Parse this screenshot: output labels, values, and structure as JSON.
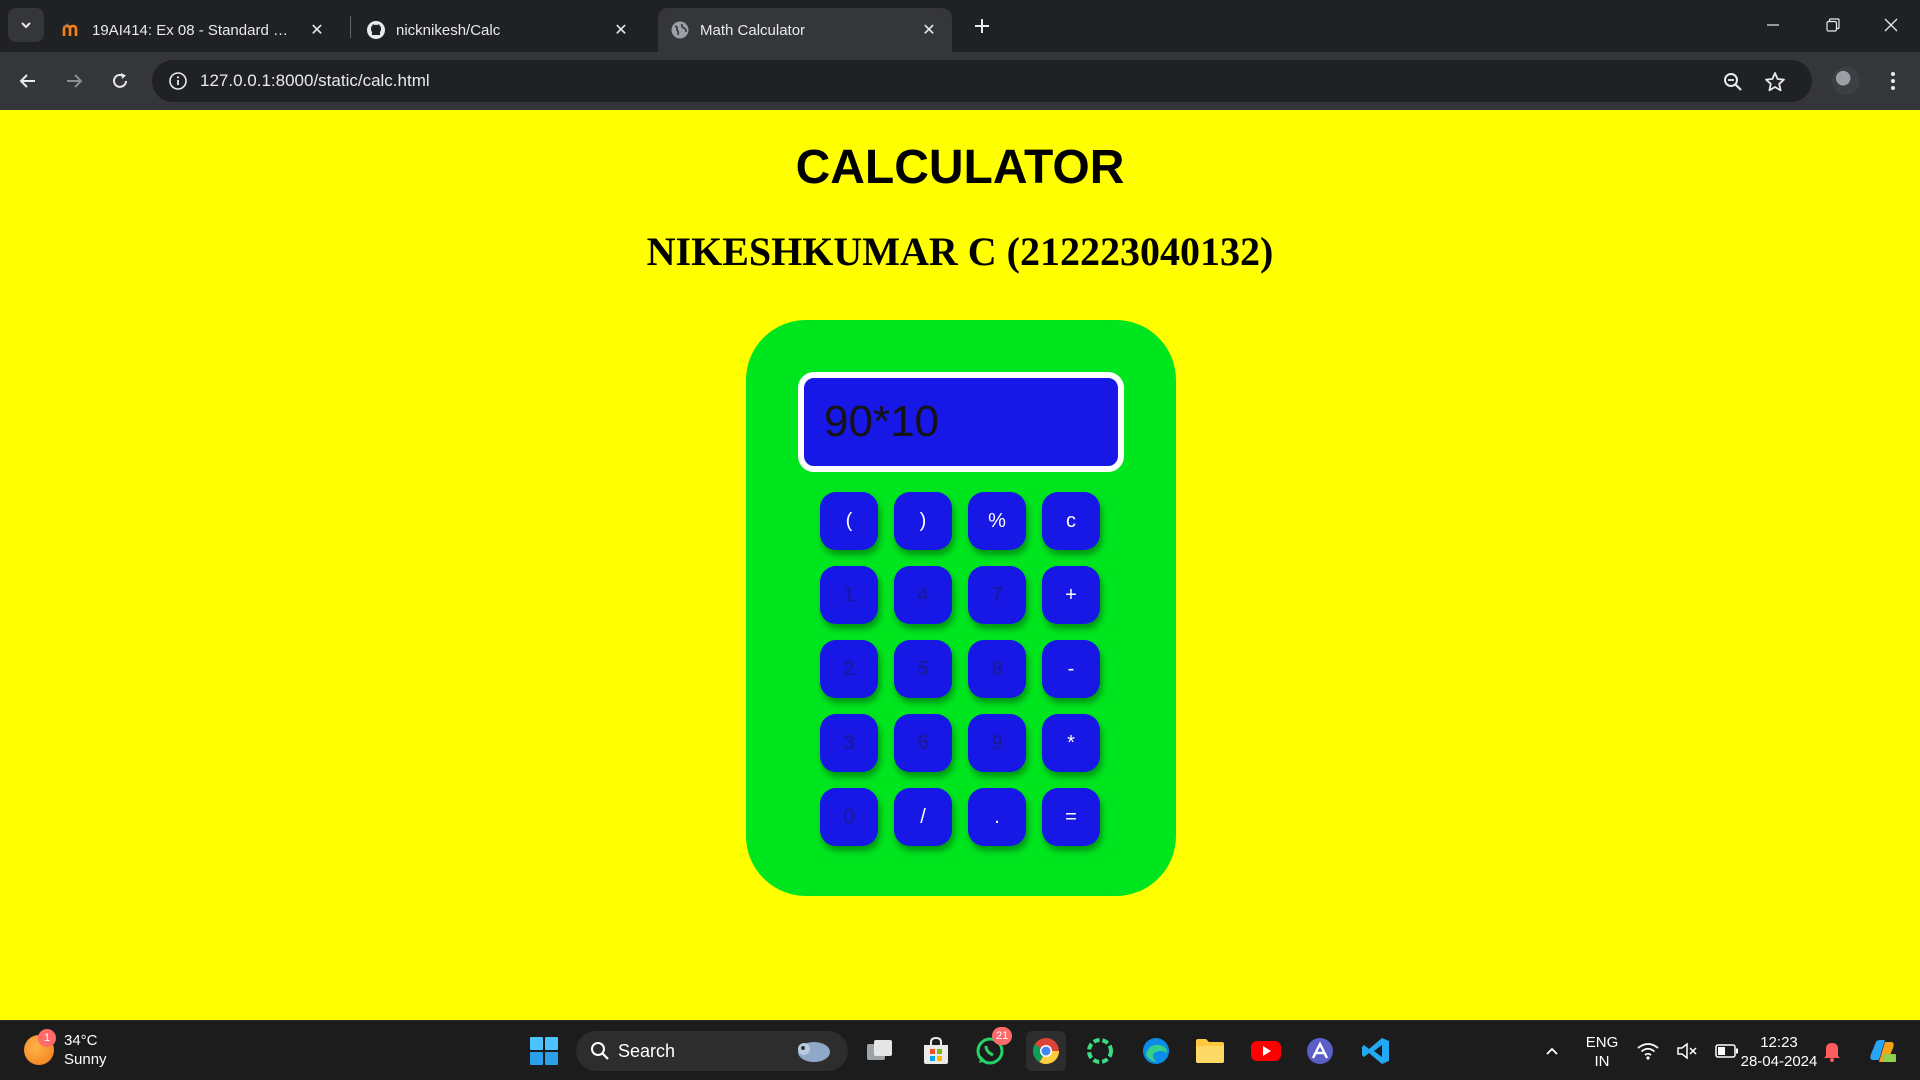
{
  "browser": {
    "tabs": [
      {
        "title": "19AI414: Ex 08 - Standard Calcu",
        "favicon": "moodle-icon",
        "active": false
      },
      {
        "title": "nicknikesh/Calc",
        "favicon": "github-icon",
        "active": false
      },
      {
        "title": "Math Calculator",
        "favicon": "globe-icon",
        "active": true
      }
    ],
    "url": "127.0.0.1:8000/static/calc.html"
  },
  "page": {
    "title": "CALCULATOR",
    "subtitle": "NIKESHKUMAR C (212223040132)",
    "background_color": "#ffff00",
    "calculator": {
      "body_color": "#00e61e",
      "display_color": "#1717e6",
      "display_value": "90*10",
      "keys": [
        {
          "label": "(",
          "tone": "light"
        },
        {
          "label": ")",
          "tone": "light"
        },
        {
          "label": "%",
          "tone": "light"
        },
        {
          "label": "c",
          "tone": "light"
        },
        {
          "label": "1",
          "tone": "dark"
        },
        {
          "label": "4",
          "tone": "dark"
        },
        {
          "label": "7",
          "tone": "dark"
        },
        {
          "label": "+",
          "tone": "light"
        },
        {
          "label": "2",
          "tone": "dark"
        },
        {
          "label": "5",
          "tone": "dark"
        },
        {
          "label": "8",
          "tone": "dark"
        },
        {
          "label": "-",
          "tone": "light"
        },
        {
          "label": "3",
          "tone": "dark"
        },
        {
          "label": "6",
          "tone": "dark"
        },
        {
          "label": "9",
          "tone": "dark"
        },
        {
          "label": "*",
          "tone": "light"
        },
        {
          "label": "0",
          "tone": "dark"
        },
        {
          "label": "/",
          "tone": "light"
        },
        {
          "label": ".",
          "tone": "light"
        },
        {
          "label": "=",
          "tone": "light"
        }
      ]
    }
  },
  "taskbar": {
    "weather": {
      "temp": "34°C",
      "condition": "Sunny",
      "badge": "1"
    },
    "search_label": "Search",
    "whatsapp_badge": "21",
    "language": {
      "line1": "ENG",
      "line2": "IN"
    },
    "clock": {
      "time": "12:23",
      "date": "28-04-2024"
    }
  }
}
